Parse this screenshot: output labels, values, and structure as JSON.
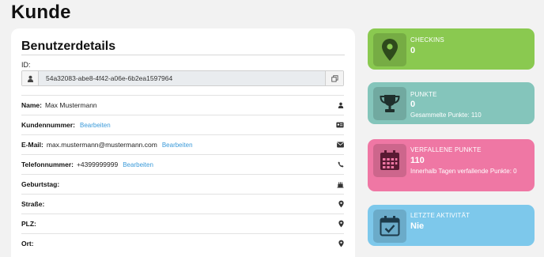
{
  "page": {
    "title": "Kunde"
  },
  "user_details": {
    "title": "Benutzerdetails",
    "id_label": "ID:",
    "id_value": "54a32083-abe8-4f42-a06e-6b2ea1597964",
    "rows": [
      {
        "label": "Name:",
        "value": "Max Mustermann",
        "edit": "",
        "icon": "user-icon"
      },
      {
        "label": "Kundennummer:",
        "value": "",
        "edit": "Bearbeiten",
        "icon": "id-card-icon"
      },
      {
        "label": "E-Mail:",
        "value": "max.mustermann@mustermann.com",
        "edit": "Bearbeiten",
        "icon": "envelope-icon"
      },
      {
        "label": "Telefonnummer:",
        "value": "+4399999999",
        "edit": "Bearbeiten",
        "icon": "phone-icon"
      },
      {
        "label": "Geburtstag:",
        "value": "",
        "edit": "",
        "icon": "cake-icon"
      },
      {
        "label": "Straße:",
        "value": "",
        "edit": "",
        "icon": "map-marker-icon"
      },
      {
        "label": "PLZ:",
        "value": "",
        "edit": "",
        "icon": "map-marker-icon"
      },
      {
        "label": "Ort:",
        "value": "",
        "edit": "",
        "icon": "map-marker-icon"
      }
    ]
  },
  "stats": {
    "checkins": {
      "label": "CHECKINS",
      "value": "0",
      "color": "#8ac950",
      "icon": "map-pin-icon"
    },
    "points": {
      "label": "PUNKTE",
      "value": "0",
      "sub": "Gesammelte Punkte: 110",
      "color": "#84c5bb",
      "icon": "trophy-icon"
    },
    "expired": {
      "label": "VERFALLENE PUNKTE",
      "value": "110",
      "sub": "Innerhalb Tagen verfallende Punkte: 0",
      "color": "#ef77a4",
      "icon": "calendar-icon"
    },
    "last_activity": {
      "label": "LETZTE AKTIVITÄT",
      "value": "Nie",
      "color": "#7dc8eb",
      "icon": "calendar-check-icon"
    }
  }
}
